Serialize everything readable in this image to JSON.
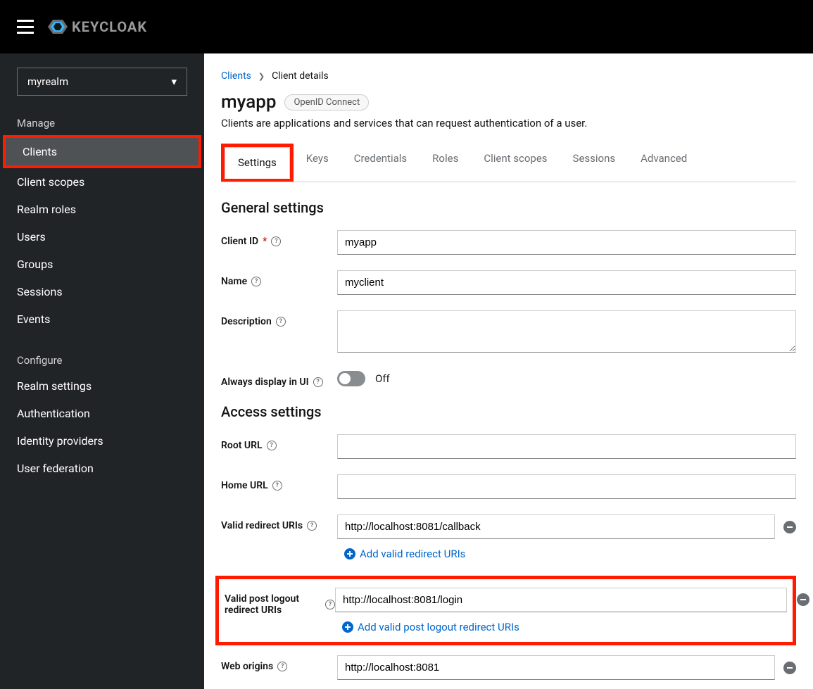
{
  "header": {
    "logo_text": "KEYCLOAK"
  },
  "sidebar": {
    "realm": "myrealm",
    "sections": {
      "manage": {
        "title": "Manage",
        "items": [
          "Clients",
          "Client scopes",
          "Realm roles",
          "Users",
          "Groups",
          "Sessions",
          "Events"
        ]
      },
      "configure": {
        "title": "Configure",
        "items": [
          "Realm settings",
          "Authentication",
          "Identity providers",
          "User federation"
        ]
      }
    }
  },
  "breadcrumb": {
    "parent": "Clients",
    "current": "Client details"
  },
  "page": {
    "title": "myapp",
    "badge": "OpenID Connect",
    "description": "Clients are applications and services that can request authentication of a user."
  },
  "tabs": [
    "Settings",
    "Keys",
    "Credentials",
    "Roles",
    "Client scopes",
    "Sessions",
    "Advanced"
  ],
  "sections": {
    "general": {
      "title": "General settings",
      "client_id_label": "Client ID",
      "client_id_value": "myapp",
      "name_label": "Name",
      "name_value": "myclient",
      "description_label": "Description",
      "description_value": "",
      "always_display_label": "Always display in UI",
      "always_display_state": "Off"
    },
    "access": {
      "title": "Access settings",
      "root_url_label": "Root URL",
      "root_url_value": "",
      "home_url_label": "Home URL",
      "home_url_value": "",
      "valid_redirect_label": "Valid redirect URIs",
      "valid_redirect_value": "http://localhost:8081/callback",
      "add_redirect_text": "Add valid redirect URIs",
      "valid_post_logout_label": "Valid post logout redirect URIs",
      "valid_post_logout_value": "http://localhost:8081/login",
      "add_post_logout_text": "Add valid post logout redirect URIs",
      "web_origins_label": "Web origins",
      "web_origins_value": "http://localhost:8081"
    }
  }
}
